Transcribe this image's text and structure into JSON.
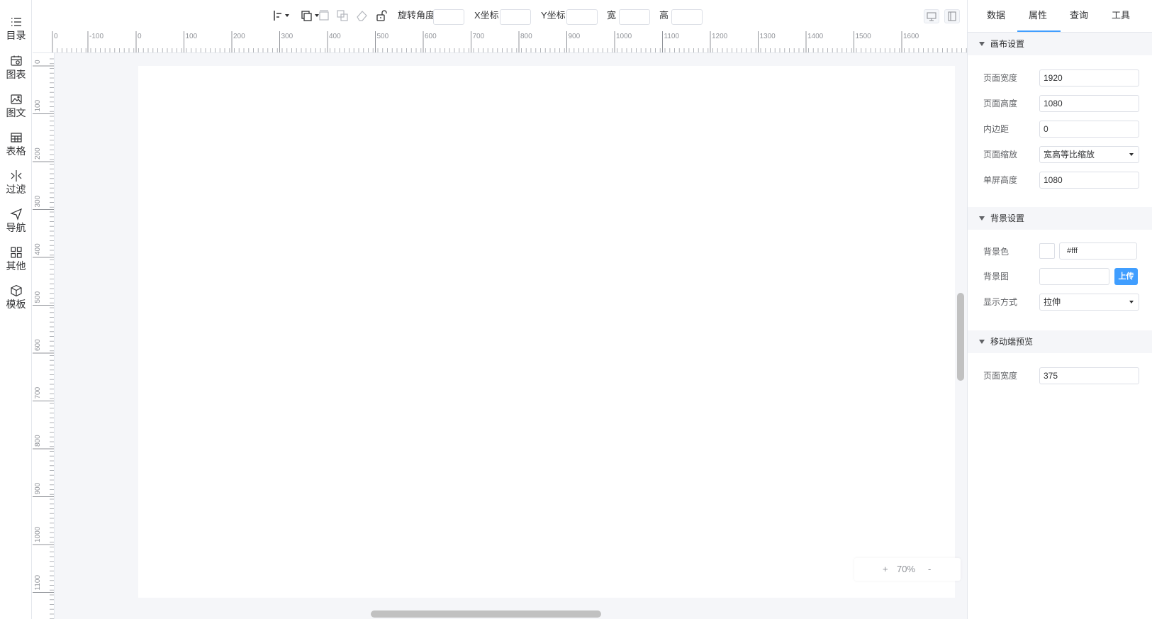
{
  "sidebar": {
    "items": [
      {
        "label": "目录",
        "icon": "list-icon"
      },
      {
        "label": "图表",
        "icon": "calendar-chart-icon"
      },
      {
        "label": "图文",
        "icon": "image-icon"
      },
      {
        "label": "表格",
        "icon": "table-icon"
      },
      {
        "label": "过滤",
        "icon": "filter-icon"
      },
      {
        "label": "导航",
        "icon": "navigation-icon"
      },
      {
        "label": "其他",
        "icon": "grid-icon"
      },
      {
        "label": "模板",
        "icon": "cube-icon"
      }
    ]
  },
  "toolbar": {
    "rotate_label": "旋转角度",
    "x_label": "X坐标",
    "y_label": "Y坐标",
    "width_label": "宽",
    "height_label": "高",
    "rotate_value": "",
    "x_value": "",
    "y_value": "",
    "width_value": "",
    "height_value": ""
  },
  "ruler": {
    "h_labels": [
      "0",
      "-100",
      "0",
      "100",
      "200",
      "300",
      "400",
      "500",
      "600",
      "700",
      "800",
      "900",
      "1000",
      "1100",
      "1200",
      "1300",
      "1400",
      "1500",
      "1600"
    ],
    "v_labels": [
      "0",
      "100",
      "200",
      "300",
      "400",
      "500",
      "600",
      "700",
      "800",
      "900",
      "1000",
      "1100"
    ]
  },
  "zoom": {
    "plus": "+",
    "value": "70%",
    "minus": "-"
  },
  "panel": {
    "tabs": [
      "数据",
      "属性",
      "查询",
      "工具"
    ],
    "active_tab": "属性",
    "canvas_section": {
      "title": "画布设置",
      "page_width_label": "页面宽度",
      "page_width": "1920",
      "page_height_label": "页面高度",
      "page_height": "1080",
      "padding_label": "内边距",
      "padding": "0",
      "scale_label": "页面缩放",
      "scale": "宽高等比缩放",
      "screen_height_label": "单屏高度",
      "screen_height": "1080"
    },
    "bg_section": {
      "title": "背景设置",
      "color_label": "背景色",
      "color": "#fff",
      "image_label": "背景图",
      "upload_label": "上传",
      "display_label": "显示方式",
      "display": "拉伸"
    },
    "mobile_section": {
      "title": "移动端预览",
      "page_width_label": "页面宽度",
      "page_width": "375"
    }
  },
  "colors": {
    "accent": "#409eff",
    "canvas_bg": "#f5f6f9",
    "page_bg": "#ffffff"
  }
}
